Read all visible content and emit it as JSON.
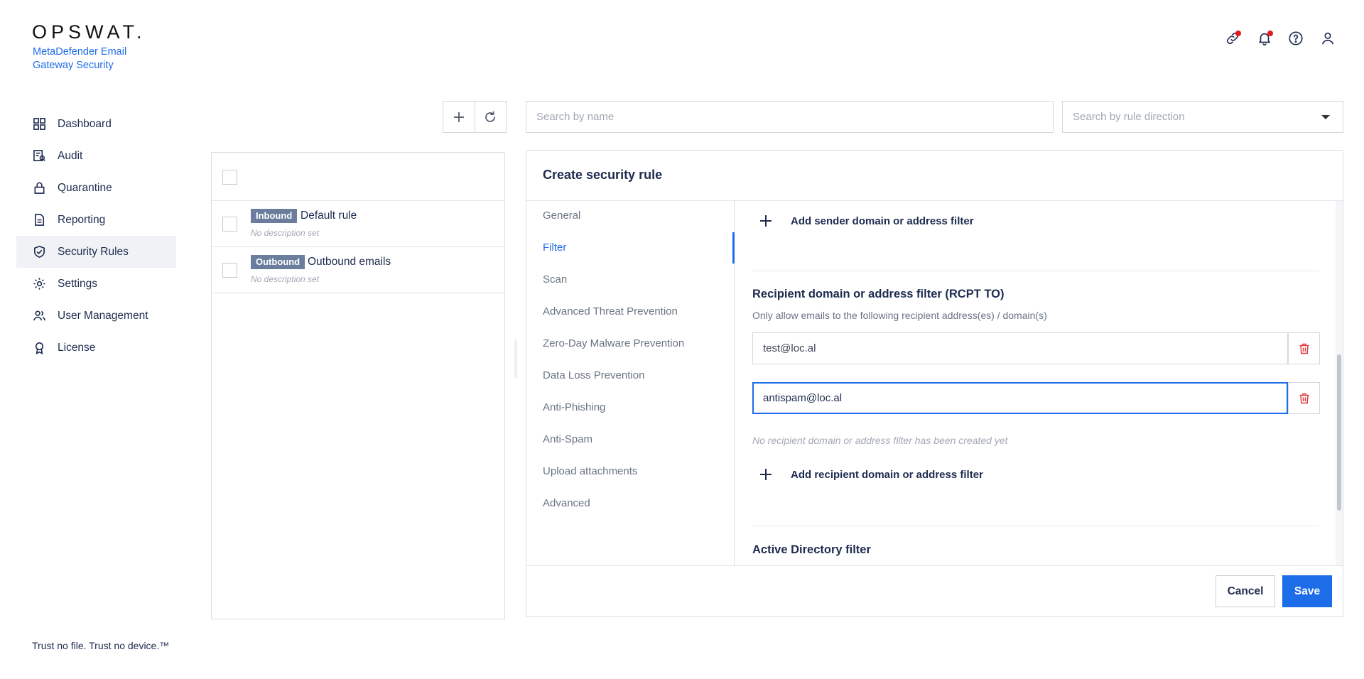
{
  "brand": {
    "logo": "OPSWAT.",
    "product": "MetaDefender Email Gateway Security",
    "tagline": "Trust no file. Trust no device.™",
    "accent_color": "#1d6ce8",
    "alert_color": "#e51a1a"
  },
  "header_icons": [
    {
      "name": "link-icon",
      "has_alert": true
    },
    {
      "name": "bell-icon",
      "has_alert": true
    },
    {
      "name": "help-icon",
      "has_alert": false
    },
    {
      "name": "user-icon",
      "has_alert": false
    }
  ],
  "sidebar": {
    "items": [
      {
        "label": "Dashboard",
        "icon": "dashboard-icon"
      },
      {
        "label": "Audit",
        "icon": "audit-icon"
      },
      {
        "label": "Quarantine",
        "icon": "lock-icon"
      },
      {
        "label": "Reporting",
        "icon": "document-icon"
      },
      {
        "label": "Security Rules",
        "icon": "shield-check-icon",
        "active": true
      },
      {
        "label": "Settings",
        "icon": "gear-icon"
      },
      {
        "label": "User Management",
        "icon": "users-icon"
      },
      {
        "label": "License",
        "icon": "badge-icon"
      }
    ]
  },
  "toolbar": {
    "add_icon": "plus-icon",
    "refresh_icon": "refresh-icon"
  },
  "search": {
    "name_placeholder": "Search by name",
    "direction_placeholder": "Search by rule direction"
  },
  "rules": [
    {
      "tag": "Inbound",
      "name": "Default rule",
      "description": "No description set"
    },
    {
      "tag": "Outbound",
      "name": "Outbound emails",
      "description": "No description set"
    }
  ],
  "editor": {
    "title": "Create security rule",
    "tabs": [
      "General",
      "Filter",
      "Scan",
      "Advanced Threat Prevention",
      "Zero-Day Malware Prevention",
      "Data Loss Prevention",
      "Anti-Phishing",
      "Anti-Spam",
      "Upload attachments",
      "Advanced"
    ],
    "active_tab": "Filter",
    "add_sender_label": "Add sender domain or address filter",
    "recipient_section": {
      "title": "Recipient domain or address filter (RCPT TO)",
      "subtitle": "Only allow emails to the following recipient address(es) / domain(s)",
      "entries": [
        "test@loc.al",
        "antispam@loc.al"
      ],
      "empty_note": "No recipient domain or address filter has been created yet",
      "add_label": "Add recipient domain or address filter"
    },
    "ad_section_title": "Active Directory filter",
    "cancel_label": "Cancel",
    "save_label": "Save"
  }
}
